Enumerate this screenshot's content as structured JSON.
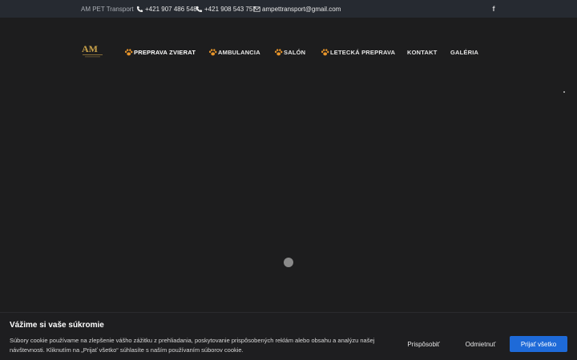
{
  "topbar": {
    "brand": "AM PET Transport",
    "phone1": "+421 907 486 548",
    "phone2": "+421 908 543 757",
    "email": "ampettransport@gmail.com",
    "facebook_icon": "facebook-icon"
  },
  "header": {
    "logo_text": "AM",
    "nav": [
      {
        "label": "PREPRAVA ZVIERAT",
        "icon": "paw-icon"
      },
      {
        "label": "AMBULANCIA",
        "icon": "paw-icon"
      },
      {
        "label": "SALÓN",
        "icon": "paw-icon"
      },
      {
        "label": "LETECKÁ PREPRAVA",
        "icon": "paw-icon"
      },
      {
        "label": "KONTAKT"
      },
      {
        "label": "GALÉRIA"
      }
    ]
  },
  "cookie": {
    "title": "Vážime si vaše súkromie",
    "text": "Súbory cookie používame na zlepšenie vášho zážitku z prehliadania, poskytovanie prispôsobených reklám alebo obsahu a analýzu našej návštevnosti. Kliknutím na „Prijať všetko“ súhlasíte s naším používaním súborov cookie.",
    "customize": "Prispôsobiť",
    "reject": "Odmietnuť",
    "accept": "Prijať všetko"
  },
  "colors": {
    "background": "#1d1d1e",
    "topbar": "#262a31",
    "accent_orange": "#e8952a",
    "logo_gold": "#c9a24a",
    "accept_button": "#1e6ad8"
  }
}
